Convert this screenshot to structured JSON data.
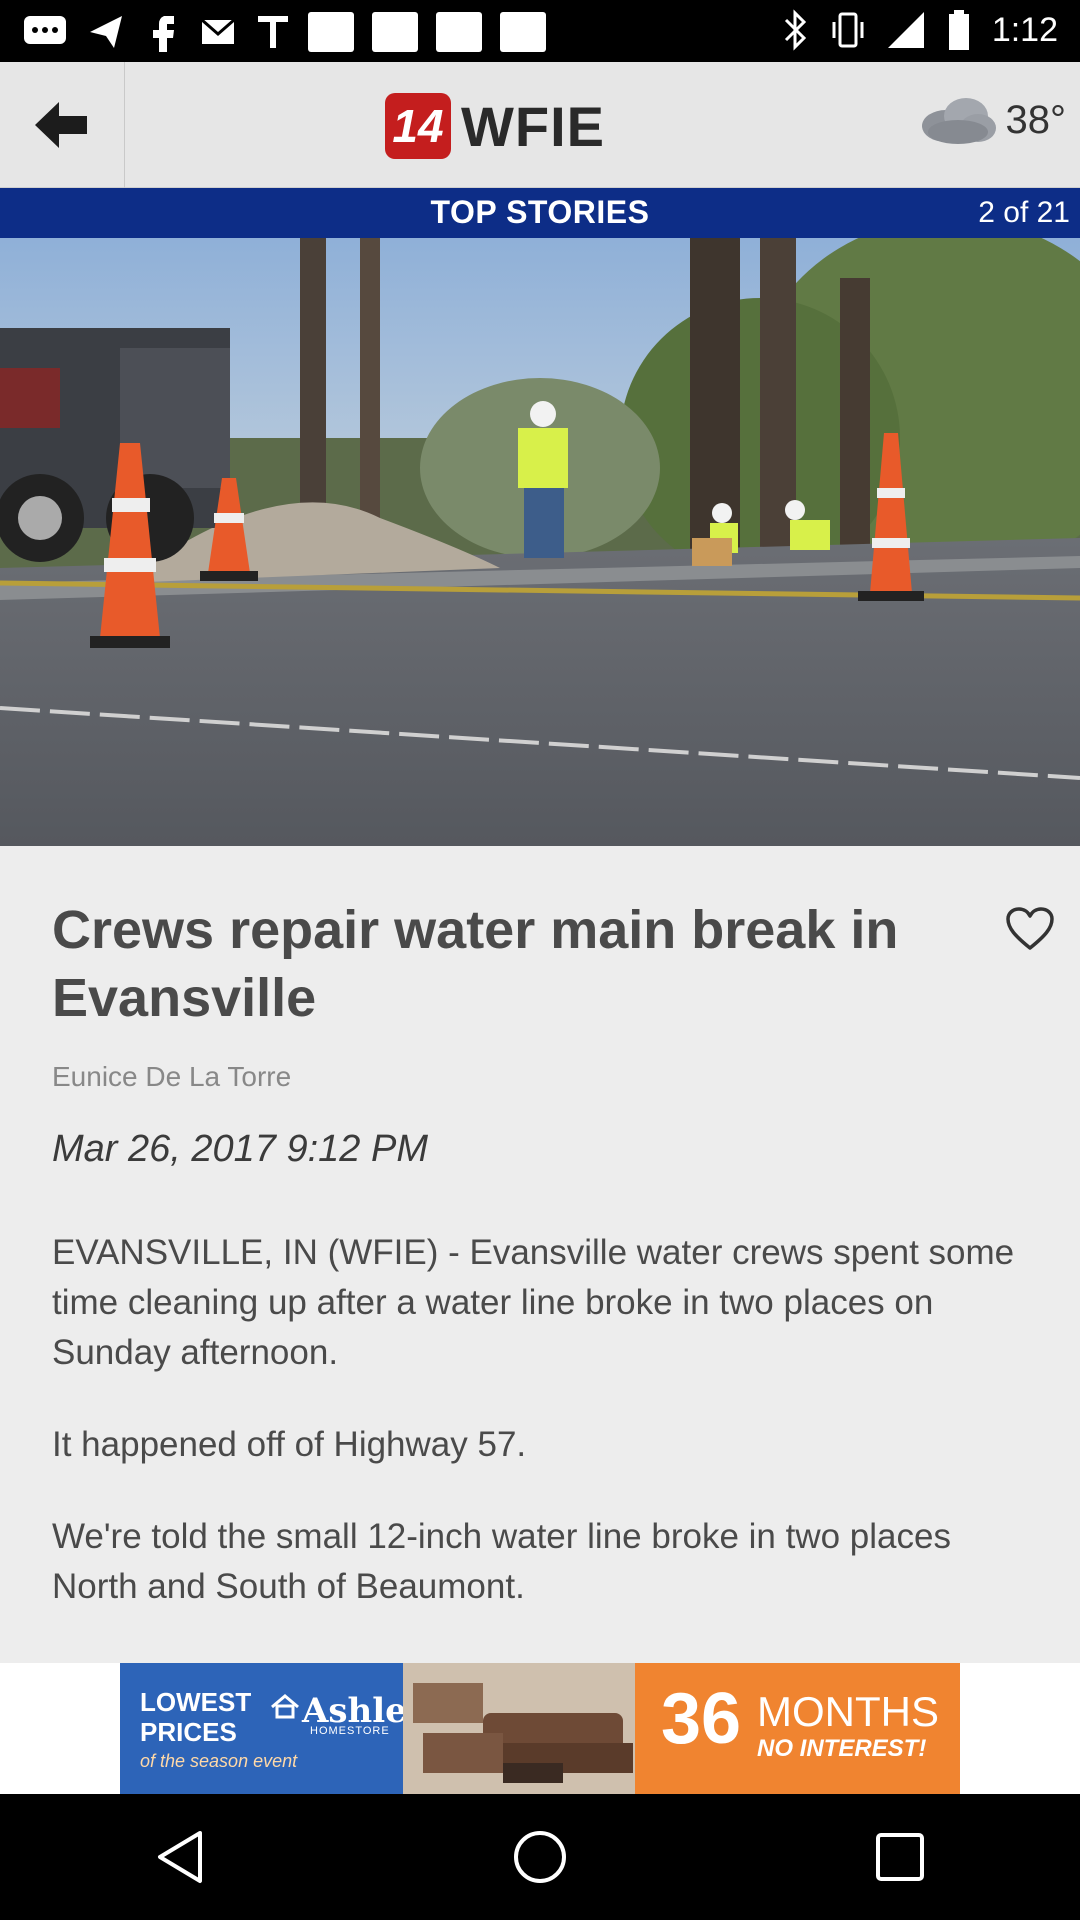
{
  "status_bar": {
    "time": "1:12"
  },
  "header": {
    "logo_number": "14",
    "logo_text": "WFIE",
    "temperature": "38°",
    "weather_icon": "cloud-icon"
  },
  "section": {
    "title": "TOP STORIES",
    "counter": "2 of 21"
  },
  "article": {
    "headline": "Crews repair water main break in Evansville",
    "author": "Eunice De La Torre",
    "date": "Mar 26, 2017 9:12 PM",
    "paragraphs": [
      "EVANSVILLE, IN (WFIE) - Evansville water crews spent some time cleaning up after a water line broke in two places on Sunday afternoon.",
      "It happened off of Highway 57.",
      "We're told the small 12-inch water line broke in two places North and South of Beaumont."
    ]
  },
  "ad": {
    "lowest_prices": "LOWEST PRICES",
    "season": "of the season event",
    "brand": "Ashley",
    "brand_sub": "HOMESTORE",
    "months_number": "36",
    "months_text": "MONTHS",
    "no_interest": "NO INTEREST!"
  },
  "colors": {
    "section_bar": "#0d2d87",
    "logo_red": "#c41e1e",
    "ad_blue": "#2d64b8",
    "ad_orange": "#f08430"
  }
}
